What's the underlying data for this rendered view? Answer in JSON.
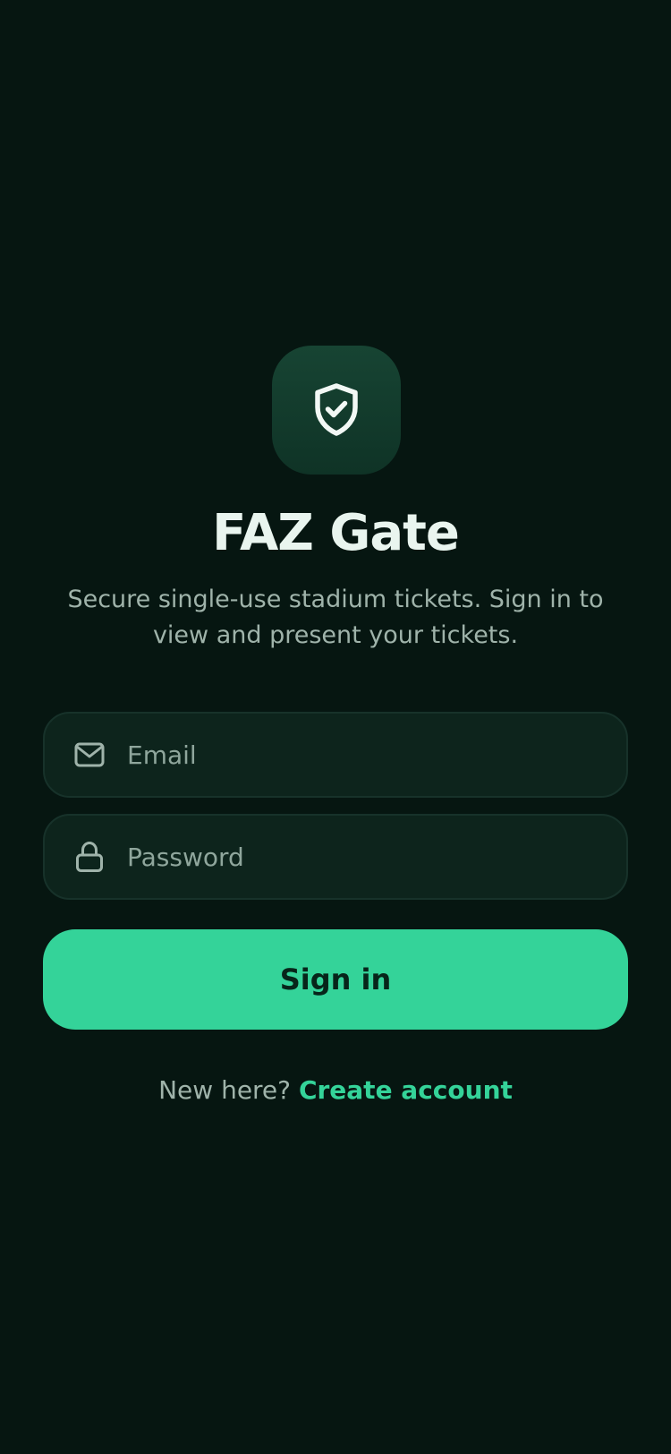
{
  "app": {
    "title": "FAZ Gate",
    "subtitle": "Secure single-use stadium tickets. Sign in to view and present your tickets.",
    "icon": "shield-check-icon"
  },
  "form": {
    "email": {
      "placeholder": "Email",
      "value": "",
      "icon": "mail-icon"
    },
    "password": {
      "placeholder": "Password",
      "value": "",
      "icon": "lock-icon"
    },
    "submit_label": "Sign in"
  },
  "footer": {
    "prompt": "New here?",
    "link_label": "Create account"
  },
  "colors": {
    "background": "#061611",
    "accent": "#34d399",
    "field_background": "#0d241c",
    "title_text": "#e9f5ef",
    "secondary_text": "#9fb3aa"
  }
}
